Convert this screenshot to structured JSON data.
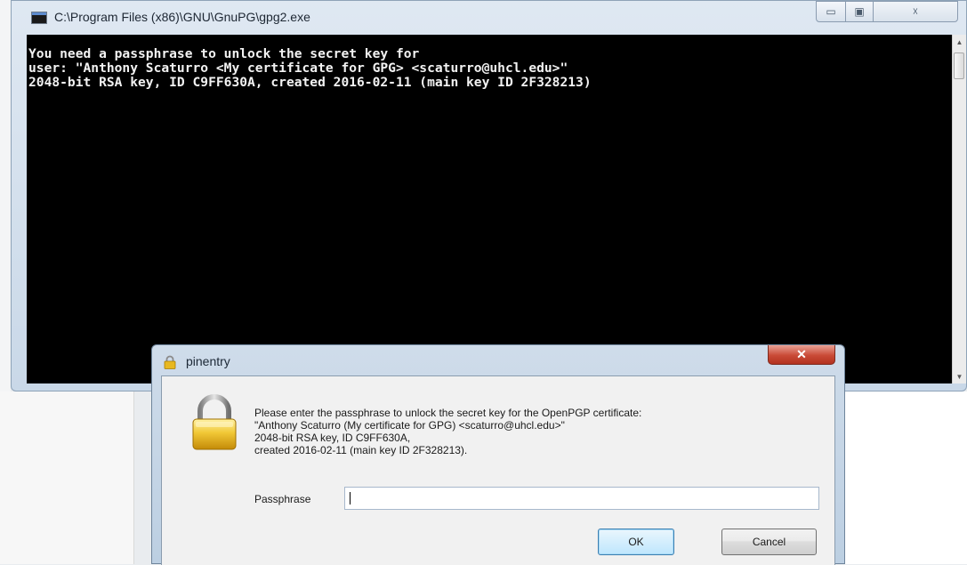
{
  "console": {
    "title": "C:\\Program Files (x86)\\GNU\\GnuPG\\gpg2.exe",
    "lines": [
      "You need a passphrase to unlock the secret key for",
      "user: \"Anthony Scaturro <My certificate for GPG> <scaturro@uhcl.edu>\"",
      "2048-bit RSA key, ID C9FF630A, created 2016-02-11 (main key ID 2F328213)"
    ],
    "text": "",
    "window_buttons": {
      "minimize": "▭",
      "maximize": "▣",
      "close": "☓"
    },
    "scroll_up": "▲",
    "scroll_down": "▼"
  },
  "pinentry": {
    "title": "pinentry",
    "close_glyph": "✕",
    "message": [
      "Please enter the passphrase to unlock the secret key for the OpenPGP certificate:",
      "\"Anthony Scaturro (My certificate for GPG) <scaturro@uhcl.edu>\"",
      "2048-bit RSA key, ID C9FF630A,",
      "created 2016-02-11 (main key ID 2F328213)."
    ],
    "passphrase_label": "Passphrase",
    "passphrase_value": "",
    "ok_label": "OK",
    "cancel_label": "Cancel"
  },
  "colors": {
    "console_background": "#000000",
    "console_text": "#f2f2f2",
    "close_button_red": "#c94a36",
    "ok_button_blue": "#bee6fd",
    "padlock_gold": "#e8b820"
  },
  "icons": {
    "console_icon": "console-window-icon",
    "dialog_icon": "lock-icon",
    "padlock": "padlock-icon"
  }
}
